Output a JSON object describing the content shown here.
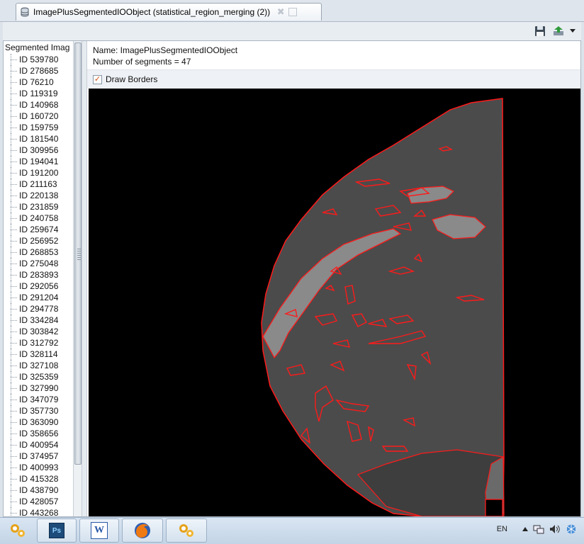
{
  "window": {
    "tab_title": "ImagePlusSegmentedIOObject (statistical_region_merging (2))",
    "tab_close_glyph": "✖"
  },
  "toolbar": {
    "icons": [
      "save-icon",
      "export-icon",
      "dropdown-arrow-icon"
    ]
  },
  "tree": {
    "root_label": "Segmented Imag",
    "items": [
      "ID 539780",
      "ID 278685",
      "ID 76210",
      "ID 119319",
      "ID 140968",
      "ID 160720",
      "ID 159759",
      "ID 181540",
      "ID 309956",
      "ID 194041",
      "ID 191200",
      "ID 211163",
      "ID 220138",
      "ID 231859",
      "ID 240758",
      "ID 259674",
      "ID 256952",
      "ID 268853",
      "ID 275048",
      "ID 283893",
      "ID 292056",
      "ID 291204",
      "ID 294778",
      "ID 334284",
      "ID 303842",
      "ID 312792",
      "ID 328114",
      "ID 327108",
      "ID 325359",
      "ID 327990",
      "ID 347079",
      "ID 357730",
      "ID 363090",
      "ID 358656",
      "ID 400954",
      "ID 374957",
      "ID 400993",
      "ID 415328",
      "ID 438790",
      "ID 428057",
      "ID 443268"
    ]
  },
  "info": {
    "name_line": "Name: ImagePlusSegmentedIOObject",
    "segments_line": "Number of segments = 47"
  },
  "draw_borders": {
    "label": "Draw Borders",
    "checked": true,
    "check_glyph": "✓"
  },
  "taskbar": {
    "apps": [
      "rapidminer-icon",
      "photoshop-icon",
      "word-icon",
      "firefox-icon",
      "rapidminer-icon"
    ],
    "ps_text": "Ps",
    "word_text": "W",
    "language": "EN",
    "tray_icons": [
      "show-hidden-icons-arrow",
      "network-icon",
      "volume-icon",
      "update-icon"
    ]
  },
  "colors": {
    "segment_fill": "#4a4a4a",
    "segment_light": "#8a8a8a",
    "border": "#ff1a1a",
    "background": "#000000"
  }
}
